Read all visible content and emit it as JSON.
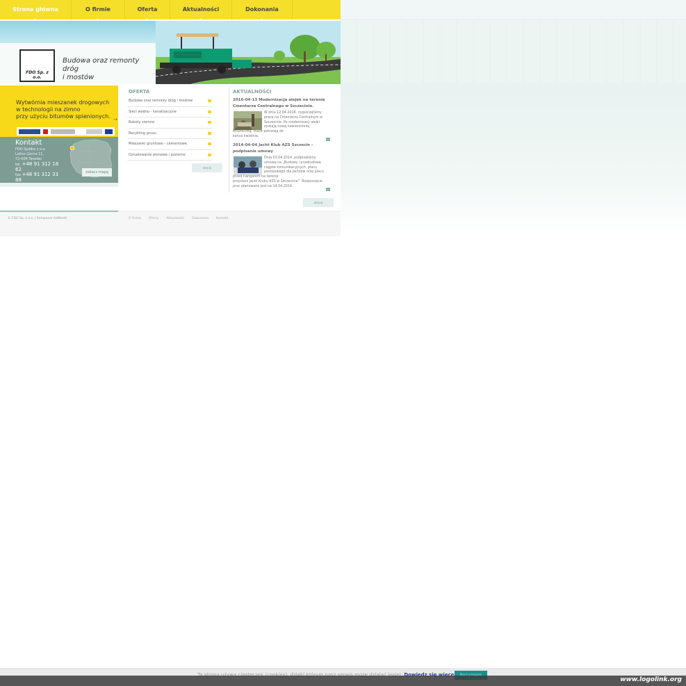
{
  "nav": {
    "items": [
      {
        "label": "Strona główna"
      },
      {
        "label": "O firmie"
      },
      {
        "label": "Oferta"
      },
      {
        "label": "Aktualności"
      },
      {
        "label": "Dokonania"
      }
    ],
    "active_index": 0,
    "bg_color": "#f6df2a"
  },
  "header": {
    "logo_text": "FDO Sp. z o.o.",
    "tagline_lines": [
      "Budowa oraz remonty",
      "dróg",
      "i mostów"
    ]
  },
  "promo": {
    "lines": [
      "Wytwórnia mieszanek drogowych",
      "w technologii na zimno",
      "przy użyciu bitumów spienionych."
    ],
    "arrow": "→"
  },
  "contact": {
    "title": "Kontakt",
    "address_lines": [
      "FDO Spółka z o.o.",
      "Lelino Górne 11,",
      "72-004 Tanowo"
    ],
    "phone_prefix": "tel.",
    "phone_lines": [
      "+48 91 312 18",
      "62"
    ],
    "fax_prefix": "fax",
    "fax_lines": [
      "+48 91 312 33",
      "88"
    ],
    "map_button": "zobacz mapę"
  },
  "oferta": {
    "heading": "OFERTA",
    "items": [
      "Budowa oraz remonty dróg i mostów",
      "Sieci wodno - kanalizacyjne",
      "Roboty ziemne",
      "Recykling gruzu",
      "Mieszanki gruntowo - cementowe",
      "Oznakowanie pionowe i poziome"
    ],
    "more_button": "więcej"
  },
  "aktualnosci": {
    "heading": "AKTUALNOŚCI",
    "news": [
      {
        "title_lines": [
          "2016-04-13 Modernizacja alejek na terenie",
          "Cmentarza Centralnego w Szczecinie."
        ],
        "body_lines": [
          "W dniu 12.04.2016. rozpoczęliśmy",
          "prace na Cmentarzu Centralnym w",
          "Szczecinie. Po modernizacji alejki",
          "zyskają nową nawierzchnię",
          "bitumiczną. Prace potrwają do",
          "końca kwietnia."
        ]
      },
      {
        "title_lines": [
          "2014-04-04 Jacht Klub AZS Szczecin -",
          "podpisanie umowy"
        ],
        "body_lines": [
          "Dnia 03.04.2014. podpisaliśmy",
          "umowę na „Budowę i przebudowę",
          "ciągów komunikacyjnych, placu",
          "postojowego dla jachtów oraz placu",
          "przed hangarem na terenie",
          "przystani Jacht Klubu AZS w Szczecinie”. Rozpoczęcie",
          "prac planowane jest na 14.04.2014."
        ]
      }
    ],
    "more_button": "więcej"
  },
  "footer": {
    "copyright": "© FDO Sp. z o.o. | Kampanie AdWords",
    "links": [
      "O firmie",
      "Oferta",
      "Aktualności",
      "Dokonania",
      "Kontakt"
    ]
  },
  "cookie": {
    "message": "Ta strona używa ciasteczek (cookies), dzięki którym nasz serwis może działać lepiej.",
    "more_link": "Dowiedz się więcej",
    "accept_button": "Rozumiem"
  },
  "watermark": "www.logolink.org"
}
